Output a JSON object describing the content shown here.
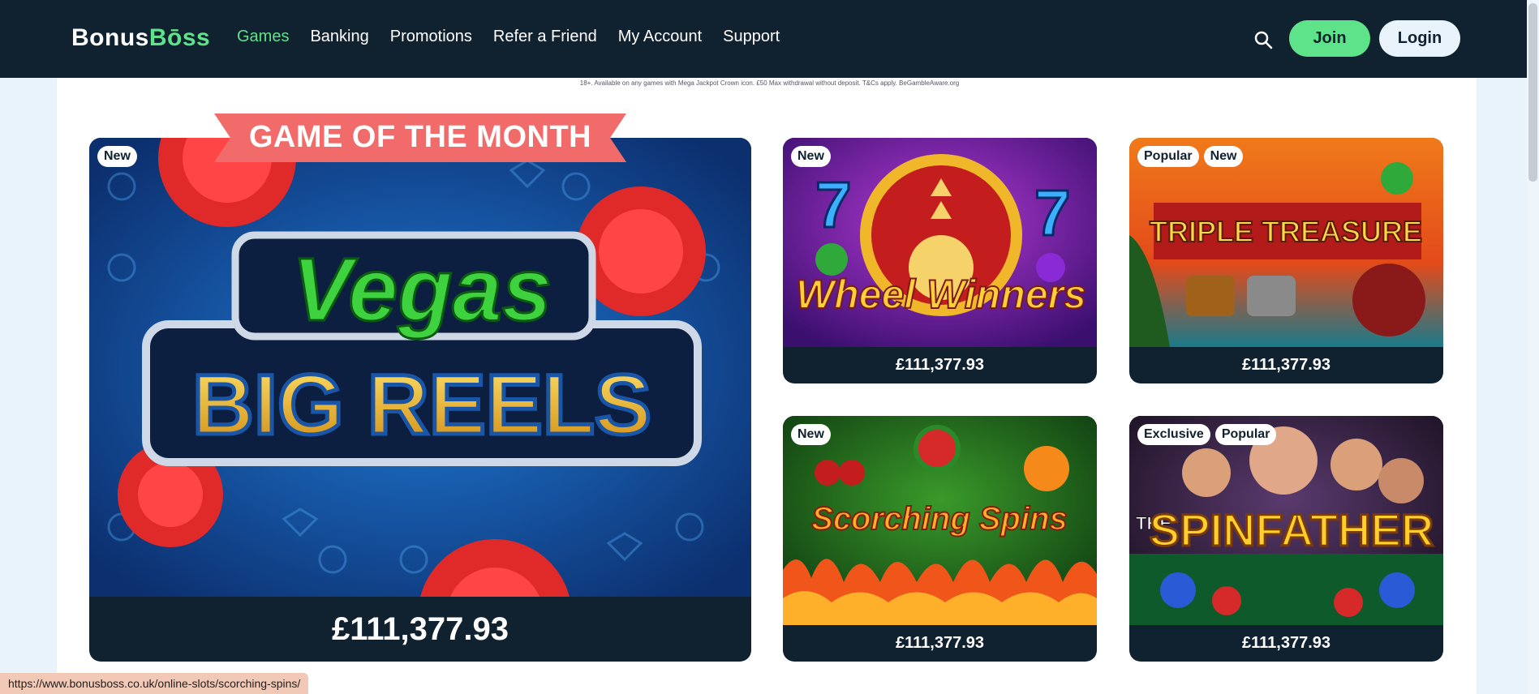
{
  "brand": {
    "logo_part1": "Bonus",
    "logo_part2": "Bōss"
  },
  "nav": {
    "links": [
      "Games",
      "Banking",
      "Promotions",
      "Refer a Friend",
      "My Account",
      "Support"
    ],
    "active": "Games",
    "join_label": "Join",
    "login_label": "Login"
  },
  "disclaimer": "18+. Available on any games with Mega Jackpot Crown icon. £50 Max withdrawal without deposit. T&Cs apply. BeGambleAware.org",
  "featured": {
    "banner": "GAME OF THE MONTH",
    "badges": [
      "New"
    ],
    "title_line1": "Vegas",
    "title_line2": "BIG REELS",
    "jackpot": "£111,377.93"
  },
  "games": [
    {
      "title": "Wheel Winners",
      "badges": [
        "New"
      ],
      "jackpot": "£111,377.93"
    },
    {
      "title": "TRIPLE TREASURE",
      "badges": [
        "Popular",
        "New"
      ],
      "jackpot": "£111,377.93"
    },
    {
      "title": "Scorching Spins",
      "badges": [
        "New"
      ],
      "jackpot": "£111,377.93"
    },
    {
      "title_prefix": "THE",
      "title": "SPINFATHER",
      "badges": [
        "Exclusive",
        "Popular"
      ],
      "jackpot": "£111,377.93"
    }
  ],
  "status_url": "https://www.bonusboss.co.uk/online-slots/scorching-spins/",
  "colors": {
    "nav_bg": "#102130",
    "accent_green": "#5fe38a",
    "banner_red": "#f26b6b"
  }
}
